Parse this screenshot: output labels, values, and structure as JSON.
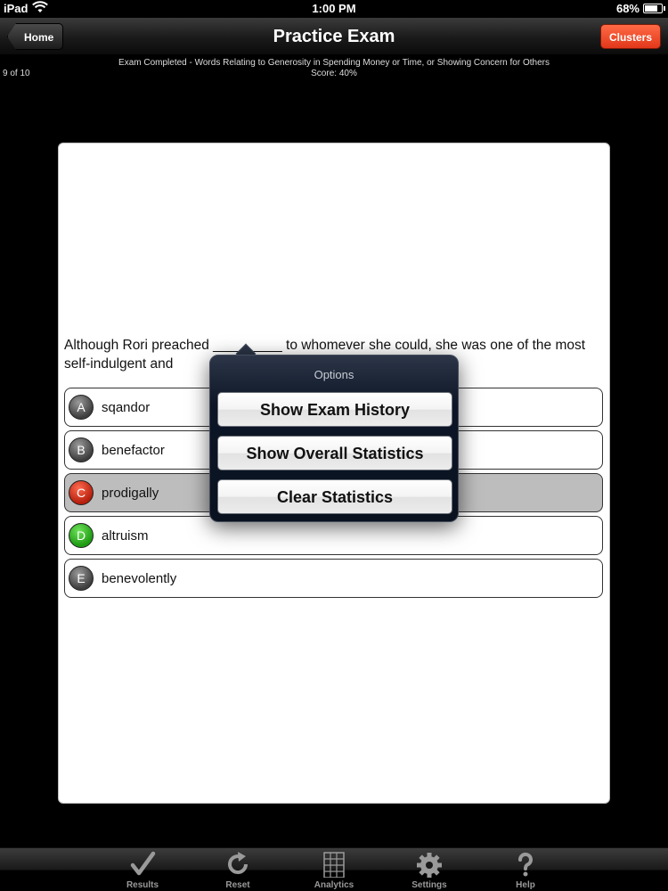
{
  "status_bar": {
    "carrier": "iPad",
    "time": "1:00 PM",
    "battery": "68%",
    "battery_level": 0.68
  },
  "nav": {
    "home_label": "Home",
    "title": "Practice Exam",
    "clusters_label": "Clusters"
  },
  "sub_header": {
    "completion": "Exam Completed - Words Relating to Generosity in Spending Money or Time, or Showing Concern for Others",
    "score": "Score: 40%",
    "progress": "9 of 10"
  },
  "question": {
    "text": "Although Rori preached _________ to whomever she could, she was one of the most self-indulgent and"
  },
  "answers": [
    {
      "letter": "A",
      "text": "sqandor",
      "state": "neutral"
    },
    {
      "letter": "B",
      "text": "benefactor",
      "state": "neutral"
    },
    {
      "letter": "C",
      "text": "prodigally",
      "state": "incorrect-selected"
    },
    {
      "letter": "D",
      "text": "altruism",
      "state": "correct"
    },
    {
      "letter": "E",
      "text": "benevolently",
      "state": "neutral"
    }
  ],
  "popover": {
    "title": "Options",
    "buttons": [
      "Show Exam History",
      "Show Overall Statistics",
      "Clear Statistics"
    ]
  },
  "tabs": [
    {
      "label": "Results",
      "icon": "checkmark-icon"
    },
    {
      "label": "Reset",
      "icon": "reset-icon"
    },
    {
      "label": "Analytics",
      "icon": "analytics-grid-icon"
    },
    {
      "label": "Settings",
      "icon": "gear-icon"
    },
    {
      "label": "Help",
      "icon": "question-mark-icon"
    }
  ],
  "colors": {
    "clusters_button": "#e1371a",
    "incorrect_letter": "#b51f0c",
    "correct_letter": "#1d9a12",
    "popover_background": "#0d1626"
  }
}
